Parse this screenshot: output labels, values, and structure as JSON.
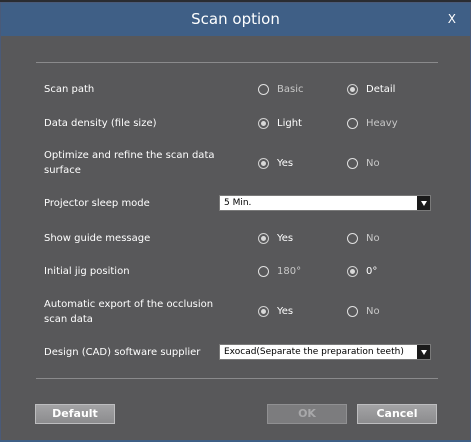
{
  "dialog": {
    "title": "Scan option",
    "close_label": "X"
  },
  "rows": [
    {
      "label": "Scan path",
      "options": [
        "Basic",
        "Detail"
      ],
      "selected": 1
    },
    {
      "label": "Data density (file size)",
      "options": [
        "Light",
        "Heavy"
      ],
      "selected": 0
    },
    {
      "label": "Optimize and refine the scan data surface",
      "options": [
        "Yes",
        "No"
      ],
      "selected": 0
    },
    {
      "label": "Projector sleep mode",
      "select_value": "5 Min."
    },
    {
      "label": "Show guide message",
      "options": [
        "Yes",
        "No"
      ],
      "selected": 0
    },
    {
      "label": "Initial jig position",
      "options": [
        "180°",
        "0°"
      ],
      "selected": 1
    },
    {
      "label": "Automatic export of the occlusion scan data",
      "options": [
        "Yes",
        "No"
      ],
      "selected": 0
    },
    {
      "label": "Design (CAD) software supplier",
      "select_value": "Exocad(Separate the preparation teeth)"
    }
  ],
  "buttons": {
    "default_label": "Default",
    "ok_label": "OK",
    "cancel_label": "Cancel"
  },
  "colors": {
    "titlebar": "#3f5f86",
    "panel": "#58585a",
    "text": "#ffffff"
  }
}
